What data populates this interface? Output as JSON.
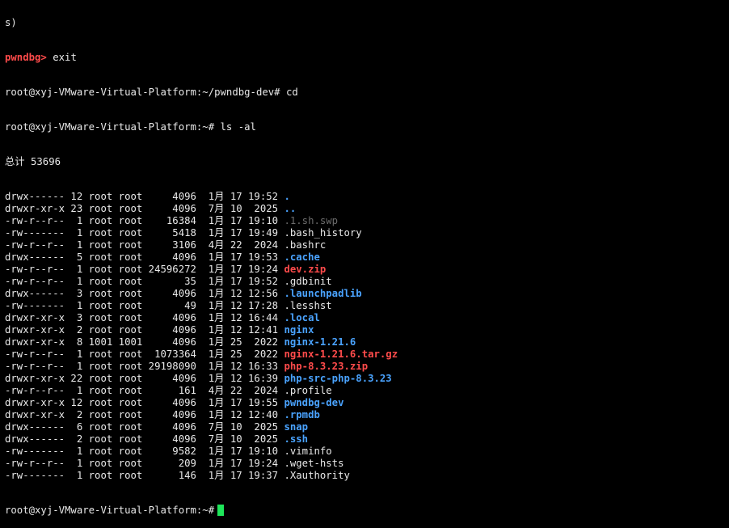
{
  "colors": {
    "background": "#000000",
    "text": "#e8e8e8",
    "directory": "#4aa3ff",
    "archive": "#ff4b4b",
    "prompt_pwndbg": "#ff4b4b",
    "dim": "#6b6b6b",
    "cursor": "#1ee65a"
  },
  "terminal": {
    "top_fragment": "s)",
    "pwndbg_prompt": "pwndbg>",
    "exit_cmd": " exit",
    "prompt1": "root@xyj-VMware-Virtual-Platform:~/pwndbg-dev# cd",
    "prompt2": "root@xyj-VMware-Virtual-Platform:~# ls -al",
    "total": "总计 53696",
    "listing": [
      {
        "meta": "drwx------ 12 root root     4096  1月 17 19:52 ",
        "name": ".",
        "kind": "dir"
      },
      {
        "meta": "drwxr-xr-x 23 root root     4096  7月 10  2025 ",
        "name": "..",
        "kind": "dir"
      },
      {
        "meta": "-rw-r--r--  1 root root    16384  1月 17 19:10 ",
        "name": ".1.sh.swp",
        "kind": "dim"
      },
      {
        "meta": "-rw-------  1 root root     5418  1月 17 19:49 ",
        "name": ".bash_history",
        "kind": "plain"
      },
      {
        "meta": "-rw-r--r--  1 root root     3106  4月 22  2024 ",
        "name": ".bashrc",
        "kind": "plain"
      },
      {
        "meta": "drwx------  5 root root     4096  1月 17 19:53 ",
        "name": ".cache",
        "kind": "dir"
      },
      {
        "meta": "-rw-r--r--  1 root root 24596272  1月 17 19:24 ",
        "name": "dev.zip",
        "kind": "archive"
      },
      {
        "meta": "-rw-r--r--  1 root root       35  1月 17 19:52 ",
        "name": ".gdbinit",
        "kind": "plain"
      },
      {
        "meta": "drwx------  3 root root     4096  1月 12 12:56 ",
        "name": ".launchpadlib",
        "kind": "dir"
      },
      {
        "meta": "-rw-------  1 root root       49  1月 12 17:28 ",
        "name": ".lesshst",
        "kind": "plain"
      },
      {
        "meta": "drwxr-xr-x  3 root root     4096  1月 12 16:44 ",
        "name": ".local",
        "kind": "dir"
      },
      {
        "meta": "drwxr-xr-x  2 root root     4096  1月 12 12:41 ",
        "name": "nginx",
        "kind": "dir"
      },
      {
        "meta": "drwxr-xr-x  8 1001 1001     4096  1月 25  2022 ",
        "name": "nginx-1.21.6",
        "kind": "dir"
      },
      {
        "meta": "-rw-r--r--  1 root root  1073364  1月 25  2022 ",
        "name": "nginx-1.21.6.tar.gz",
        "kind": "archive"
      },
      {
        "meta": "-rw-r--r--  1 root root 29198090  1月 12 16:33 ",
        "name": "php-8.3.23.zip",
        "kind": "archive"
      },
      {
        "meta": "drwxr-xr-x 22 root root     4096  1月 12 16:39 ",
        "name": "php-src-php-8.3.23",
        "kind": "dir"
      },
      {
        "meta": "-rw-r--r--  1 root root      161  4月 22  2024 ",
        "name": ".profile",
        "kind": "plain"
      },
      {
        "meta": "drwxr-xr-x 12 root root     4096  1月 17 19:55 ",
        "name": "pwndbg-dev",
        "kind": "dir"
      },
      {
        "meta": "drwxr-xr-x  2 root root     4096  1月 12 12:40 ",
        "name": ".rpmdb",
        "kind": "dir"
      },
      {
        "meta": "drwx------  6 root root     4096  7月 10  2025 ",
        "name": "snap",
        "kind": "dir"
      },
      {
        "meta": "drwx------  2 root root     4096  7月 10  2025 ",
        "name": ".ssh",
        "kind": "dir"
      },
      {
        "meta": "-rw-------  1 root root     9582  1月 17 19:10 ",
        "name": ".viminfo",
        "kind": "plain"
      },
      {
        "meta": "-rw-r--r--  1 root root      209  1月 17 19:24 ",
        "name": ".wget-hsts",
        "kind": "plain"
      },
      {
        "meta": "-rw-------  1 root root      146  1月 17 19:37 ",
        "name": ".Xauthority",
        "kind": "plain"
      }
    ],
    "final_prompt": "root@xyj-VMware-Virtual-Platform:~#"
  }
}
